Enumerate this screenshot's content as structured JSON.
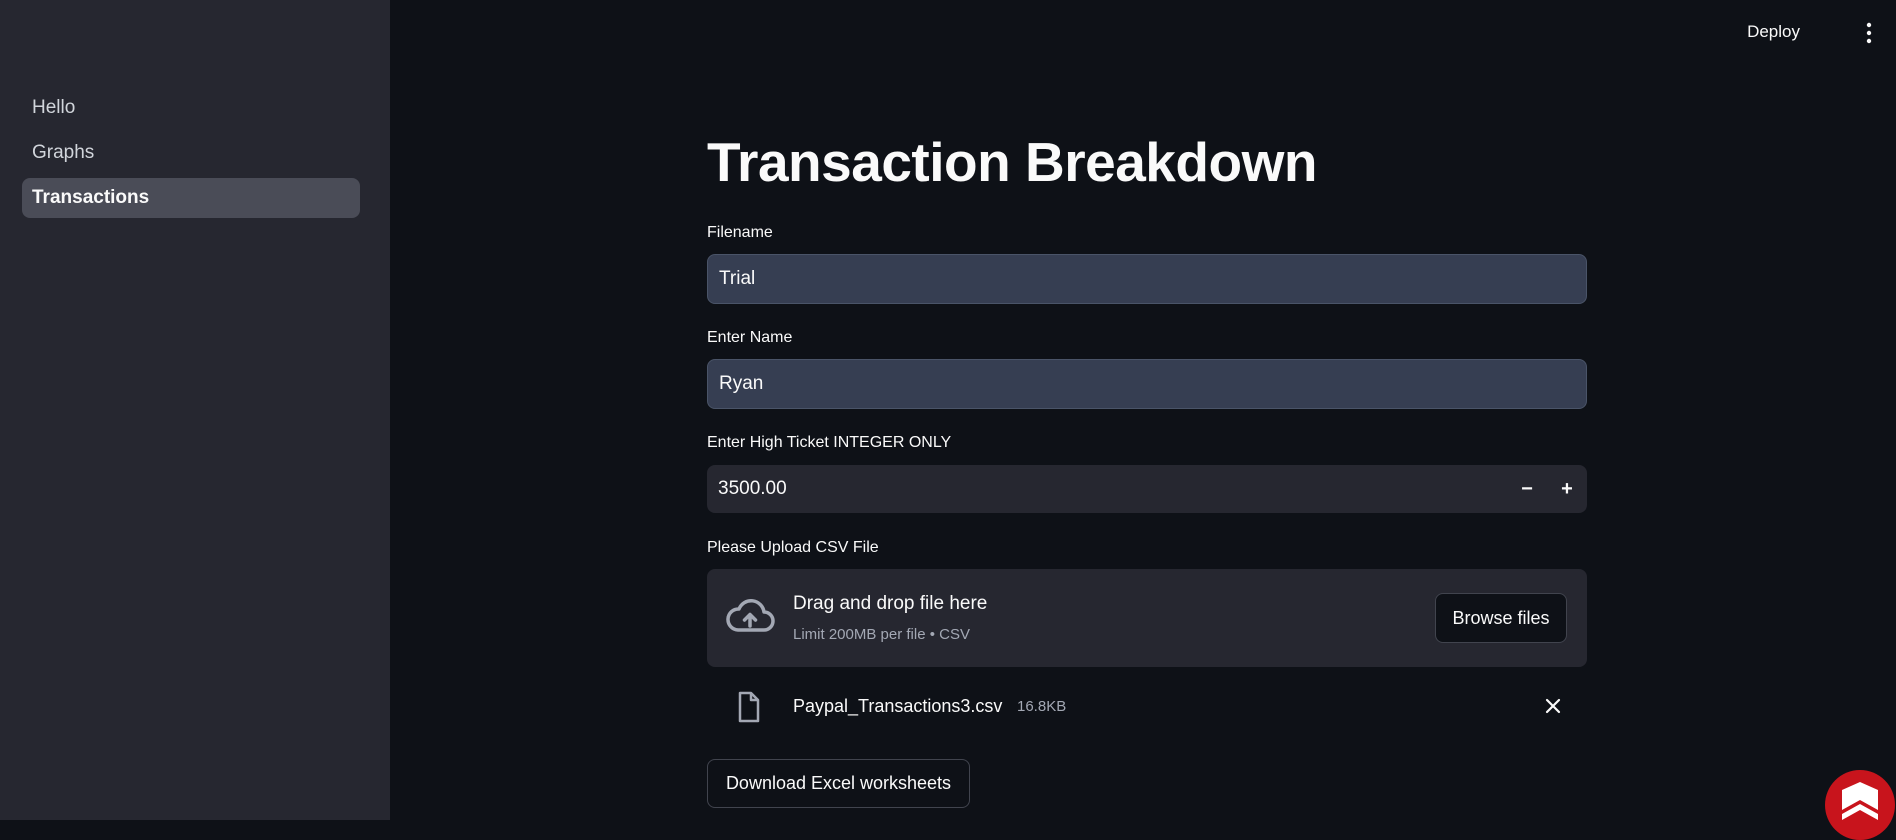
{
  "sidebar": {
    "items": [
      {
        "label": "Hello"
      },
      {
        "label": "Graphs"
      },
      {
        "label": "Transactions"
      }
    ]
  },
  "header": {
    "deploy_label": "Deploy",
    "menu_icon": "kebab-menu-icon"
  },
  "main": {
    "title": "Transaction Breakdown",
    "filename": {
      "label": "Filename",
      "value": "Trial"
    },
    "name": {
      "label": "Enter Name",
      "value": "Ryan"
    },
    "high_ticket": {
      "label": "Enter High Ticket INTEGER ONLY",
      "value": "3500.00",
      "minus": "−",
      "plus": "+"
    },
    "upload": {
      "label": "Please Upload CSV File",
      "drop_title": "Drag and drop file here",
      "drop_sub": "Limit 200MB per file • CSV",
      "browse_label": "Browse files",
      "icon": "cloud-upload-icon"
    },
    "uploaded_file": {
      "name": "Paypal_Transactions3.csv",
      "size": "16.8KB",
      "icon": "file-icon",
      "remove_icon": "close-icon"
    },
    "download_label": "Download Excel worksheets"
  },
  "colors": {
    "background": "#0e1117",
    "sidebar": "#262730",
    "active_nav": "#4a4c57",
    "input": "#363e52",
    "badge": "#c8141c"
  }
}
